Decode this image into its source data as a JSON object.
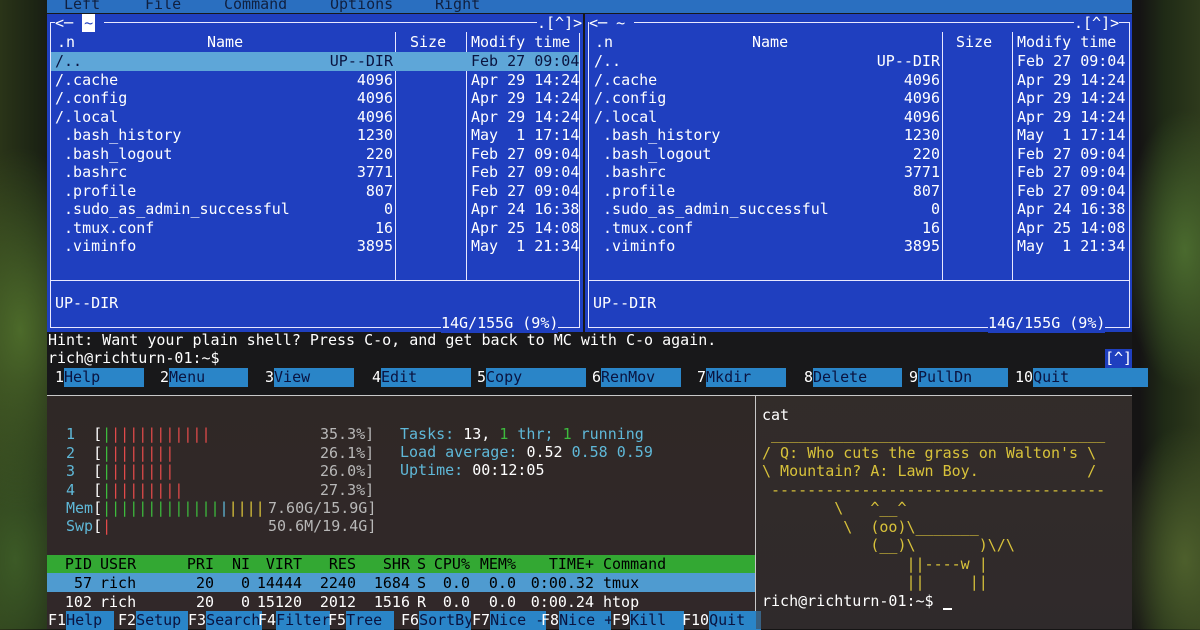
{
  "mc": {
    "menu": [
      "Left",
      "File",
      "Command",
      "Options",
      "Right"
    ],
    "left_panel": {
      "path_prefix": "<─ ",
      "path": "~",
      "top_right": ".[^]>",
      "columns": [
        ".n",
        "Name",
        "Size",
        "Modify time"
      ],
      "rows": [
        {
          "name": "/..",
          "size": "UP--DIR",
          "time": "Feb 27 09:04",
          "selected": true
        },
        {
          "name": "/.cache",
          "size": "4096",
          "time": "Apr 29 14:24"
        },
        {
          "name": "/.config",
          "size": "4096",
          "time": "Apr 29 14:24"
        },
        {
          "name": "/.local",
          "size": "4096",
          "time": "Apr 29 14:24"
        },
        {
          "name": " .bash_history",
          "size": "1230",
          "time": "May  1 17:14"
        },
        {
          "name": " .bash_logout",
          "size": "220",
          "time": "Feb 27 09:04"
        },
        {
          "name": " .bashrc",
          "size": "3771",
          "time": "Feb 27 09:04"
        },
        {
          "name": " .profile",
          "size": "807",
          "time": "Feb 27 09:04"
        },
        {
          "name": " .sudo_as_admin_successful",
          "size": "0",
          "time": "Apr 24 16:38"
        },
        {
          "name": " .tmux.conf",
          "size": "16",
          "time": "Apr 25 14:08"
        },
        {
          "name": " .viminfo",
          "size": "3895",
          "time": "May  1 21:34"
        }
      ],
      "status": "UP--DIR",
      "disk": "14G/155G (9%)"
    },
    "right_panel": {
      "path_prefix": "<─ ",
      "path": "~",
      "top_right": ".[^]>",
      "columns": [
        ".n",
        "Name",
        "Size",
        "Modify time"
      ],
      "rows": [
        {
          "name": "/..",
          "size": "UP--DIR",
          "time": "Feb 27 09:04"
        },
        {
          "name": "/.cache",
          "size": "4096",
          "time": "Apr 29 14:24"
        },
        {
          "name": "/.config",
          "size": "4096",
          "time": "Apr 29 14:24"
        },
        {
          "name": "/.local",
          "size": "4096",
          "time": "Apr 29 14:24"
        },
        {
          "name": " .bash_history",
          "size": "1230",
          "time": "May  1 17:14"
        },
        {
          "name": " .bash_logout",
          "size": "220",
          "time": "Feb 27 09:04"
        },
        {
          "name": " .bashrc",
          "size": "3771",
          "time": "Feb 27 09:04"
        },
        {
          "name": " .profile",
          "size": "807",
          "time": "Feb 27 09:04"
        },
        {
          "name": " .sudo_as_admin_successful",
          "size": "0",
          "time": "Apr 24 16:38"
        },
        {
          "name": " .tmux.conf",
          "size": "16",
          "time": "Apr 25 14:08"
        },
        {
          "name": " .viminfo",
          "size": "3895",
          "time": "May  1 21:34"
        }
      ],
      "status": "UP--DIR",
      "disk": "14G/155G (9%)"
    },
    "hint": "Hint: Want your plain shell? Press C-o, and get back to MC with C-o again.",
    "prompt": "rich@richturn-01:~$",
    "bracket": "[^]",
    "fkeys": [
      {
        "n": "1",
        "l": "Help"
      },
      {
        "n": "2",
        "l": "Menu"
      },
      {
        "n": "3",
        "l": "View"
      },
      {
        "n": "4",
        "l": "Edit"
      },
      {
        "n": "5",
        "l": "Copy"
      },
      {
        "n": "6",
        "l": "RenMov"
      },
      {
        "n": "7",
        "l": "Mkdir"
      },
      {
        "n": "8",
        "l": "Delete"
      },
      {
        "n": "9",
        "l": "PullDn"
      },
      {
        "n": "10",
        "l": "Quit"
      }
    ]
  },
  "htop": {
    "cpus": [
      {
        "id": "1",
        "bars": "||||||||||||",
        "pct": "35.3%]"
      },
      {
        "id": "2",
        "bars": "||||||||",
        "pct": "26.1%]"
      },
      {
        "id": "3",
        "bars": "||||||||",
        "pct": "26.0%]"
      },
      {
        "id": "4",
        "bars": "|||||||||",
        "pct": "27.3%]"
      }
    ],
    "mem": {
      "label": "Mem[",
      "bars": "||||||||||||||||||",
      "value": "7.60G/15.9G]"
    },
    "swp": {
      "label": "Swp[",
      "bars": "|",
      "value": "50.6M/19.4G]"
    },
    "tasks_label": "Tasks:",
    "tasks": "13,",
    "thr": "1",
    "thr_label": "thr;",
    "running": "1",
    "running_label": "running",
    "load_label": "Load average:",
    "load1": "0.52",
    "load5": "0.58",
    "load15": "0.59",
    "uptime_label": "Uptime:",
    "uptime": "00:12:05",
    "columns": [
      "PID",
      "USER",
      "PRI",
      "NI",
      "VIRT",
      "RES",
      "SHR",
      "S",
      "CPU%",
      "MEM%",
      "TIME+",
      "Command"
    ],
    "processes": [
      [
        "57",
        "rich",
        "20",
        "0",
        "14444",
        "2240",
        "1684",
        "S",
        "0.0",
        "0.0",
        "0:00.32",
        "tmux"
      ],
      [
        "102",
        "rich",
        "20",
        "0",
        "15120",
        "2012",
        "1516",
        "R",
        "0.0",
        "0.0",
        "0:00.24",
        "htop"
      ]
    ],
    "fkeys": [
      {
        "n": "F1",
        "l": "Help"
      },
      {
        "n": "F2",
        "l": "Setup"
      },
      {
        "n": "F3",
        "l": "Search"
      },
      {
        "n": "F4",
        "l": "Filter"
      },
      {
        "n": "F5",
        "l": "Tree"
      },
      {
        "n": "F6",
        "l": "SortBy"
      },
      {
        "n": "F7",
        "l": "Nice -"
      },
      {
        "n": "F8",
        "l": "Nice +"
      },
      {
        "n": "F9",
        "l": "Kill"
      },
      {
        "n": "F10",
        "l": "Quit"
      }
    ]
  },
  "cowsay": {
    "command": "cat",
    "lines": [
      " _____________________________________",
      "/ Q: Who cuts the grass on Walton's \\",
      "\\ Mountain? A: Lawn Boy.            /",
      " -------------------------------------",
      "        \\   ^__^",
      "         \\  (oo)\\_______",
      "            (__)\\       )\\/\\",
      "                ||----w |",
      "                ||     ||"
    ],
    "prompt": "rich@richturn-01:~$"
  }
}
